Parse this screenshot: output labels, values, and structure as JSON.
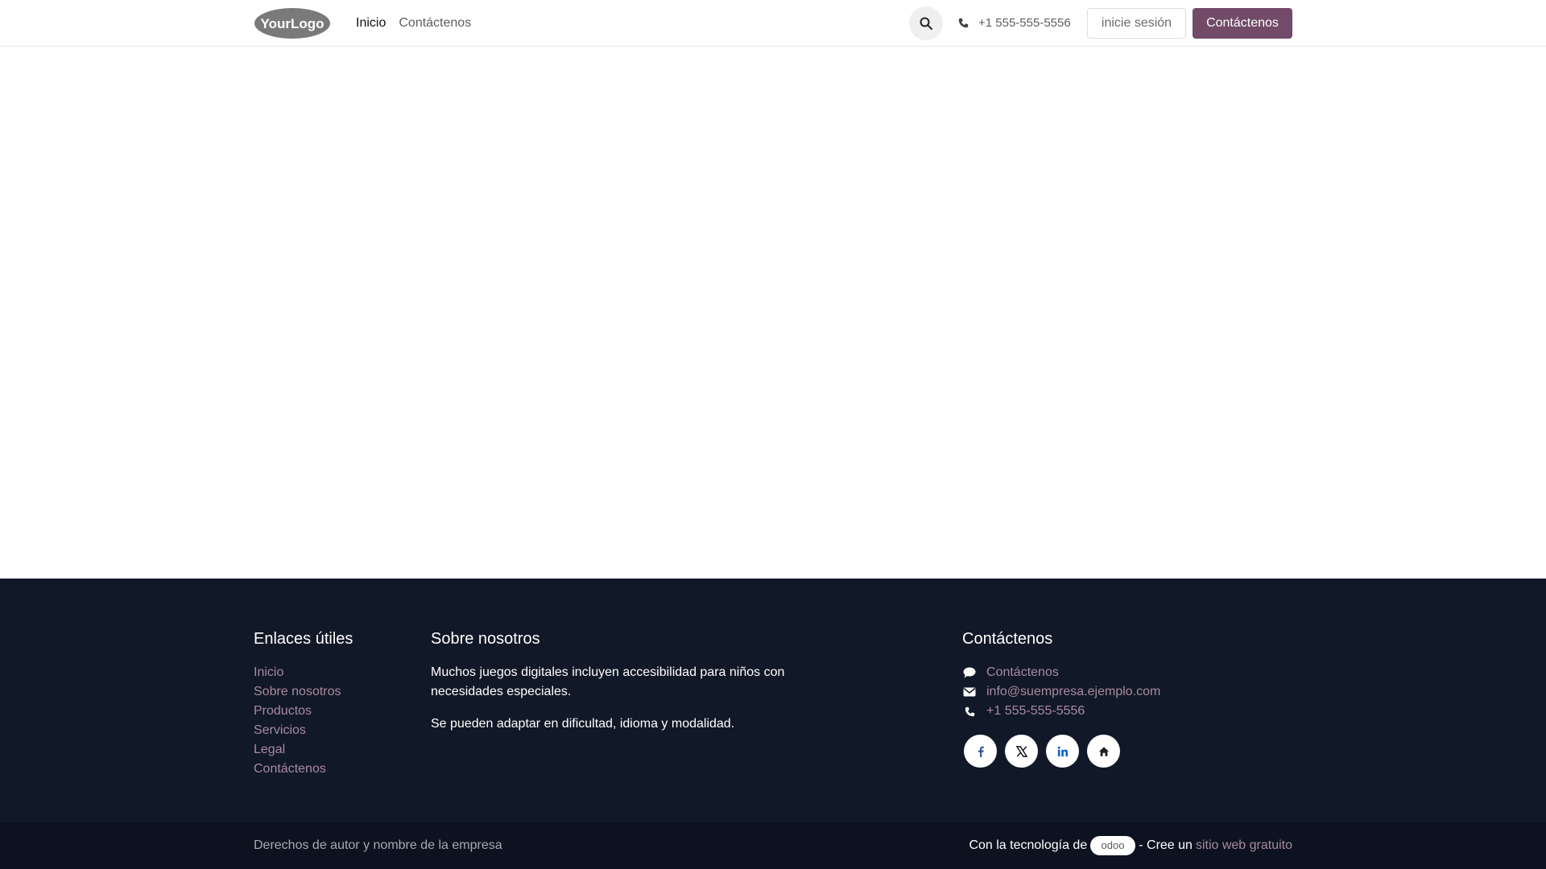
{
  "header": {
    "logo_text": "YourLogo",
    "nav": [
      {
        "label": "Inicio",
        "active": true
      },
      {
        "label": "Contáctenos",
        "active": false
      }
    ],
    "search_icon": "search-icon",
    "phone": "+1 555-555-5556",
    "login_label": "inicie sesión",
    "contact_label": "Contáctenos",
    "accent_color": "#714b67"
  },
  "footer": {
    "links_title": "Enlaces útiles",
    "links": [
      "Inicio",
      "Sobre nosotros",
      "Productos",
      "Servicios",
      "Legal",
      "Contáctenos"
    ],
    "about_title": "Sobre nosotros",
    "about_p1": "Muchos juegos digitales incluyen accesibilidad para niños con necesidades especiales.",
    "about_p2": "Se pueden adaptar en dificultad, idioma y modalidad.",
    "contact_title": "Contáctenos",
    "contact_items": [
      {
        "icon": "comment-icon",
        "label": "Contáctenos"
      },
      {
        "icon": "envelope-icon",
        "label": "info@suempresa.ejemplo.com"
      },
      {
        "icon": "phone-icon",
        "label": "+1 555-555-5556"
      }
    ],
    "socials": [
      "facebook-icon",
      "x-twitter-icon",
      "linkedin-icon",
      "home-icon"
    ],
    "background_color": "#111827"
  },
  "copyright": {
    "left": "Derechos de autor y nombre de la empresa",
    "powered_prefix": "Con la tecnología de",
    "odoo_badge": "odoo",
    "create_text": "- Cree un",
    "create_link": "sitio web gratuito"
  }
}
